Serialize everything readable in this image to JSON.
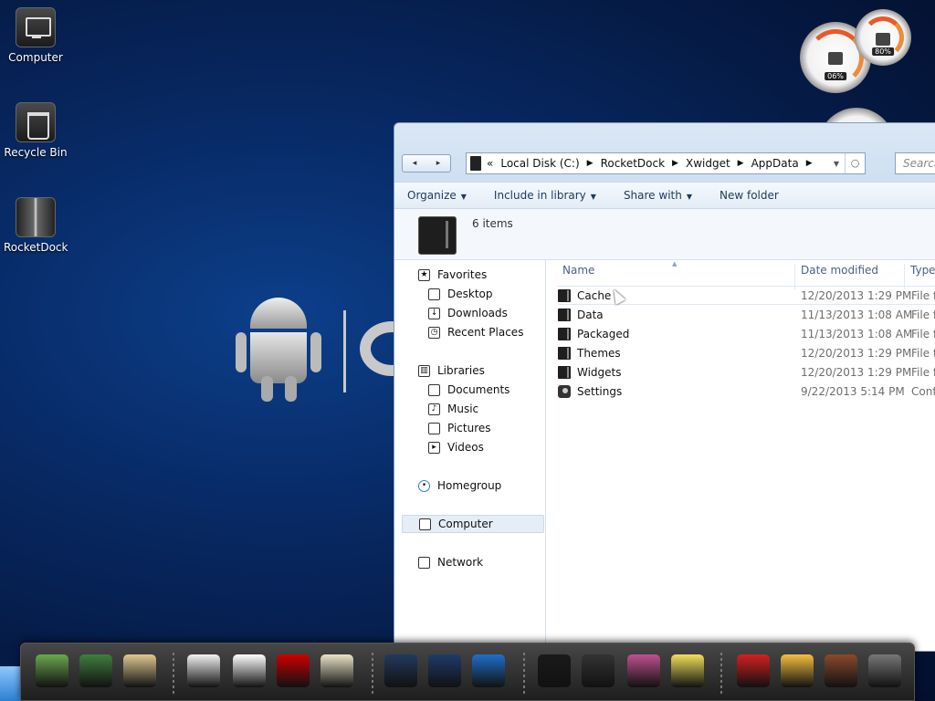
{
  "desktop": {
    "icons": [
      {
        "label": "Computer",
        "icon": "computer-icon"
      },
      {
        "label": "Recycle Bin",
        "icon": "recycle-bin-icon"
      },
      {
        "label": "RocketDock",
        "icon": "rocketdock-icon"
      }
    ]
  },
  "gauges": {
    "cpu": "06%",
    "memory": "80%"
  },
  "explorer": {
    "address": {
      "prefix": "«",
      "crumbs": [
        "Local Disk (C:)",
        "RocketDock",
        "Xwidget",
        "AppData"
      ]
    },
    "search_placeholder": "Search",
    "toolbar": {
      "organize": "Organize",
      "include_in_library": "Include in library",
      "share_with": "Share with",
      "new_folder": "New folder"
    },
    "details": {
      "item_count": "6 items"
    },
    "nav": {
      "favorites": "Favorites",
      "desktop": "Desktop",
      "downloads": "Downloads",
      "recent_places": "Recent Places",
      "libraries": "Libraries",
      "documents": "Documents",
      "music": "Music",
      "pictures": "Pictures",
      "videos": "Videos",
      "homegroup": "Homegroup",
      "computer": "Computer",
      "network": "Network"
    },
    "columns": {
      "name": "Name",
      "date_modified": "Date modified",
      "type": "Type"
    },
    "files": [
      {
        "name": "Cache",
        "date": "12/20/2013 1:29 PM",
        "type": "File fo",
        "icon": "folder-icon"
      },
      {
        "name": "Data",
        "date": "11/13/2013 1:08 AM",
        "type": "File fo",
        "icon": "folder-icon"
      },
      {
        "name": "Packaged",
        "date": "11/13/2013 1:08 AM",
        "type": "File fo",
        "icon": "folder-icon"
      },
      {
        "name": "Themes",
        "date": "12/20/2013 1:29 PM",
        "type": "File fo",
        "icon": "folder-icon"
      },
      {
        "name": "Widgets",
        "date": "12/20/2013 1:29 PM",
        "type": "File fo",
        "icon": "folder-icon"
      },
      {
        "name": "Settings",
        "date": "9/22/2013 5:14 PM",
        "type": "Confi",
        "icon": "config-file-icon"
      }
    ]
  },
  "dock": {
    "items": [
      {
        "icon": "android-screenshot-icon",
        "color": "#6aa84f"
      },
      {
        "icon": "globe-screen-icon",
        "color": "#3f7f3f"
      },
      {
        "icon": "android-folder-icon",
        "color": "#e0c890"
      },
      {
        "icon": "play-store-icon",
        "color": "#f2f2f2"
      },
      {
        "icon": "gmail-icon",
        "color": "#ffffff"
      },
      {
        "icon": "youtube-icon",
        "color": "#cc0000"
      },
      {
        "icon": "maps-icon",
        "color": "#e9e3c6"
      },
      {
        "icon": "camera-icon",
        "color": "#223a5e"
      },
      {
        "icon": "speaker-icon",
        "color": "#1e3b6a"
      },
      {
        "icon": "browser-icon",
        "color": "#1f6fcc"
      },
      {
        "icon": "color-tv-icon",
        "color": "#1a1a1a"
      },
      {
        "icon": "calculator-icon",
        "color": "#333333"
      },
      {
        "icon": "photo-gallery-icon",
        "color": "#c05090"
      },
      {
        "icon": "sticky-note-icon",
        "color": "#f2e05a"
      },
      {
        "icon": "angry-birds-icon",
        "color": "#d42020"
      },
      {
        "icon": "weather-icon",
        "color": "#f4c040"
      },
      {
        "icon": "gingerbread-icon",
        "color": "#8a4a2a"
      },
      {
        "icon": "trash-icon",
        "color": "#777777"
      }
    ]
  }
}
